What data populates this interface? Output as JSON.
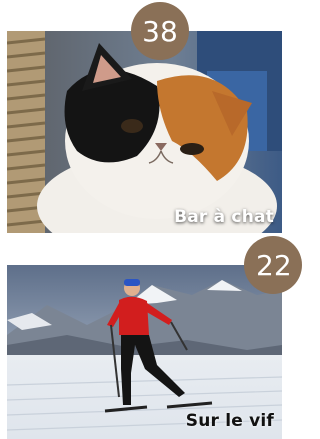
{
  "cards": [
    {
      "caption": "Bar à chat",
      "count": "38",
      "scene": "cat-photo"
    },
    {
      "caption": "Sur le vif",
      "count": "22",
      "scene": "cross-country-skier-photo"
    }
  ],
  "colors": {
    "badge": "#8a7057"
  }
}
